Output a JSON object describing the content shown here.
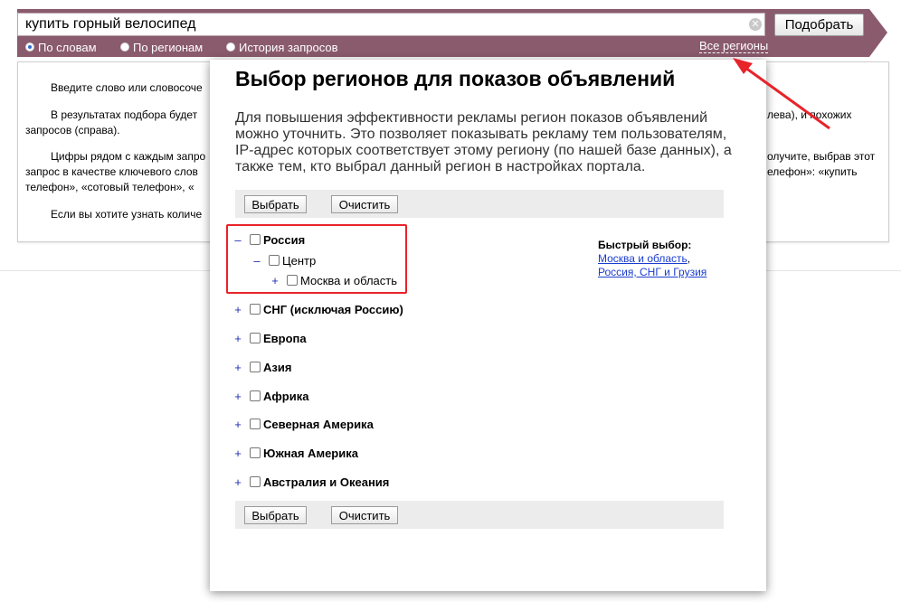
{
  "search": {
    "query": "купить горный велосипед",
    "submit_label": "Подобрать"
  },
  "search_modes": [
    {
      "label": "По словам",
      "selected": true
    },
    {
      "label": "По регионам",
      "selected": false
    },
    {
      "label": "История запросов",
      "selected": false
    }
  ],
  "all_regions_link": "Все регионы",
  "info_panel": {
    "line1": "Введите слово или словосоче",
    "line2": "В результатах подбора будет",
    "line2_tail": "лева), и похожих",
    "line3": "запросов (справа).",
    "line4": "Цифры рядом с каждым запро",
    "line4_tail": "олучите, выбрав этот",
    "line5": "запрос в качестве ключевого слов",
    "line5_tail": "елефон»: «купить",
    "line6": "телефон», «сотовый телефон», «",
    "line7": "Если вы хотите узнать количе"
  },
  "modal": {
    "title": "Выбор регионов для показов объявлений",
    "description": "Для повышения эффективности рекламы регион показов объявлений можно уточнить. Это позволяет показывать рекламу тем пользователям, IP-адрес которых соответствует этому региону (по нашей базе данных), а также тем, кто выбрал данный регион в настройках портала.",
    "select_label": "Выбрать",
    "clear_label": "Очистить",
    "regions": {
      "russia": {
        "toggle": "–",
        "label": "Россия"
      },
      "center": {
        "toggle": "–",
        "label": "Центр"
      },
      "moscow": {
        "toggle": "+",
        "label": "Москва и область"
      },
      "cis": {
        "toggle": "+",
        "label": "СНГ (исключая Россию)"
      },
      "europe": {
        "toggle": "+",
        "label": "Европа"
      },
      "asia": {
        "toggle": "+",
        "label": "Азия"
      },
      "africa": {
        "toggle": "+",
        "label": "Африка"
      },
      "north_america": {
        "toggle": "+",
        "label": "Северная Америка"
      },
      "south_america": {
        "toggle": "+",
        "label": "Южная Америка"
      },
      "australia": {
        "toggle": "+",
        "label": "Австралия и Океания"
      }
    },
    "quick_select": {
      "title": "Быстрый выбор:",
      "link1": "Москва и область",
      "separator": ",",
      "link2": "Россия, СНГ и Грузия"
    }
  },
  "colors": {
    "header_bg": "#8a5a6d",
    "annotation_red": "#e8232a",
    "link_blue": "#1a3ccf"
  },
  "icons": {
    "clear": "close-circle-icon",
    "expand": "plus-icon",
    "collapse": "minus-icon"
  }
}
